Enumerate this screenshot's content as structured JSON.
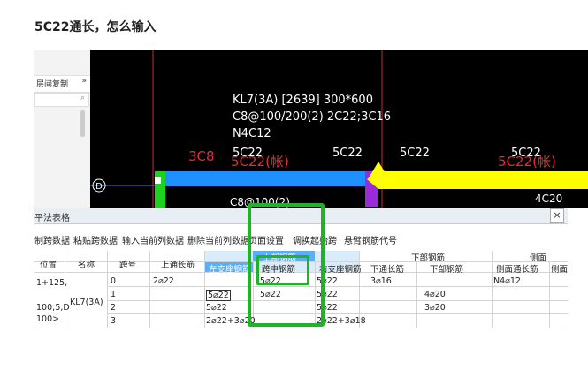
{
  "question": "5C22通长，怎么输入",
  "left_panel": {
    "label": "层间复制",
    "more": "»",
    "search_icon": "⌕"
  },
  "cad": {
    "beam_label_1": "KL7(3A) [2639] 300*600",
    "beam_label_2": "C8@100/200(2) 2C22;3C16",
    "beam_label_3": "N4C12",
    "top_label_a": "5C22",
    "top_label_b": "5C22",
    "top_label_c": "5C22",
    "top_label_d": "5C22",
    "red_label_a": "3C8",
    "red_label_b": "5C22(帐)",
    "red_label_c": "5C22(帐)",
    "axis_label": "D",
    "bottom_label_a": "C8@100(2)",
    "bottom_label_b": "4C20",
    "colors": {
      "beam_blue": "#1e90ff",
      "beam_yellow": "#ffff00",
      "purple": "#9a2bd8",
      "green": "#1fd11f",
      "red": "#e03030"
    }
  },
  "table_window": {
    "title": "平法表格",
    "close": "×",
    "toolbar": [
      "制跨数据",
      "粘贴跨数据",
      "输入当前列数据",
      "删除当前列数据",
      "页面设置",
      "调换起始跨",
      "悬臂钢筋代号"
    ],
    "headers": {
      "position": "位置",
      "name": "名称",
      "span": "跨号",
      "top_through": "上通长筋",
      "left_seat": "左支座钢筋",
      "upper_group": "上部钢筋",
      "mid_span": "跨中钢筋",
      "right_seat": "右支座钢筋",
      "lower_group": "下部钢筋",
      "lower_through": "下通长筋",
      "lower_rebar": "下部钢筋",
      "side_group": "侧面",
      "side_through": "侧面通长筋",
      "side_extra": "侧面"
    },
    "position_lines": [
      "1+125,",
      "100;5,D",
      "100>"
    ],
    "name_value": "KL7(3A)",
    "rows": [
      {
        "span": "0",
        "top": "2⌀22",
        "left": "",
        "mid": "5⌀22",
        "right": "5⌀22",
        "lower_through": "3⌀16",
        "lower": "",
        "side": "N4⌀12"
      },
      {
        "span": "1",
        "top": "",
        "left": "5⌀22",
        "mid": "5⌀22",
        "right": "5⌀22",
        "lower_through": "",
        "lower": "4⌀20",
        "side": ""
      },
      {
        "span": "2",
        "top": "",
        "left": "5⌀22",
        "mid": "",
        "right": "5⌀22",
        "lower_through": "",
        "lower": "3⌀20",
        "side": ""
      },
      {
        "span": "3",
        "top": "",
        "left": "2⌀22+3⌀20",
        "mid": "",
        "right": "2⌀22+3⌀18",
        "lower_through": "",
        "lower": "",
        "side": ""
      }
    ]
  }
}
